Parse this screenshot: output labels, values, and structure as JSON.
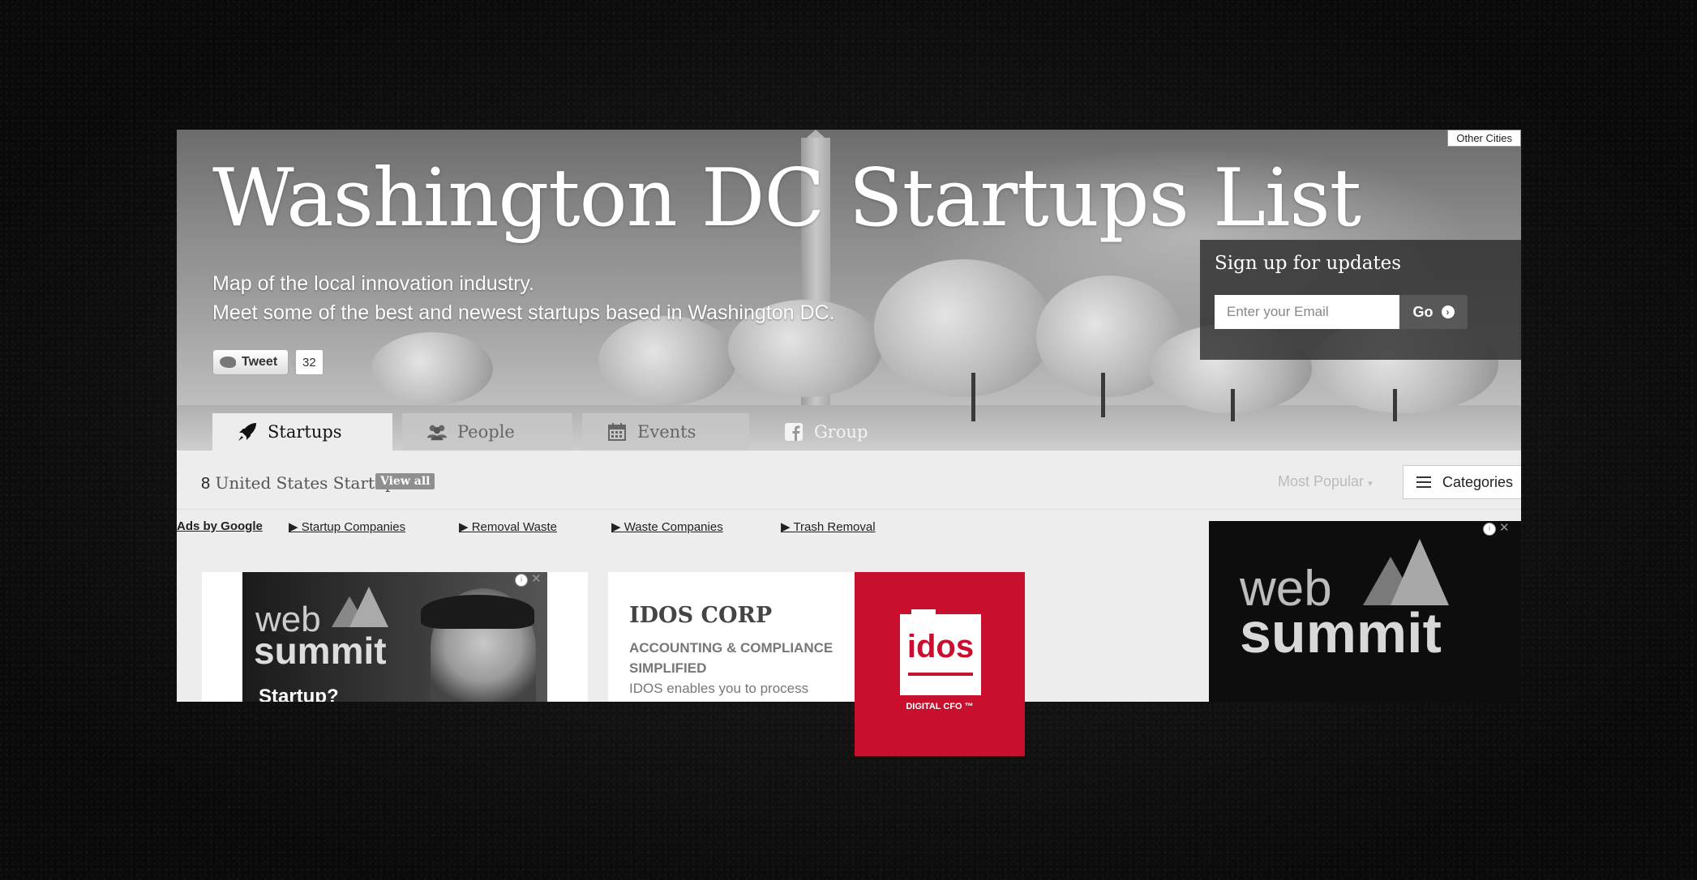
{
  "header": {
    "other_cities": "Other Cities",
    "title": "Washington DC Startups List",
    "subtitle_line1": "Map of the local innovation industry.",
    "subtitle_line2": "Meet some of the best and newest startups based in Washington DC.",
    "tweet_label": "Tweet",
    "tweet_count": "32"
  },
  "signup": {
    "title": "Sign up for updates",
    "email_placeholder": "Enter your Email",
    "go_label": "Go"
  },
  "tabs": [
    {
      "label": "Startups",
      "icon": "rocket-icon",
      "active": true
    },
    {
      "label": "People",
      "icon": "people-icon",
      "active": false
    },
    {
      "label": "Events",
      "icon": "calendar-icon",
      "active": false
    },
    {
      "label": "Group",
      "icon": "facebook-icon",
      "active": false
    }
  ],
  "toolbar": {
    "count_number": "8",
    "count_text": "United States Startups",
    "view_all": "View all",
    "sort_label": "Most Popular",
    "categories_label": "Categories"
  },
  "ads": {
    "ads_by_google": "Ads by Google",
    "links": [
      "Startup Companies",
      "Removal Waste",
      "Waste Companies",
      "Trash Removal"
    ]
  },
  "websummit_ad": {
    "word1": "web",
    "word2": "summit",
    "teaser": "Startup?"
  },
  "idos_ad": {
    "title": "IDOS CORP",
    "line1": "ACCOUNTING & COMPLIANCE",
    "line2": "SIMPLIFIED",
    "desc": "IDOS enables you to process",
    "logo_text": "idos",
    "tagline": "DIGITAL CFO ™",
    "brand_color": "#c8102e"
  }
}
